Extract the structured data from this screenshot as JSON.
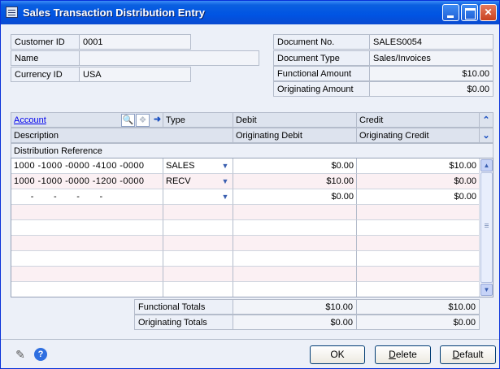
{
  "window": {
    "title": "Sales Transaction Distribution Entry"
  },
  "header": {
    "customer_id_label": "Customer ID",
    "customer_id": "0001",
    "name_label": "Name",
    "name": "",
    "currency_id_label": "Currency ID",
    "currency_id": "USA",
    "document_no_label": "Document No.",
    "document_no": "SALES0054",
    "document_type_label": "Document Type",
    "document_type": "Sales/Invoices",
    "functional_amount_label": "Functional Amount",
    "functional_amount": "$10.00",
    "originating_amount_label": "Originating Amount",
    "originating_amount": "$0.00"
  },
  "grid_header": {
    "account": "Account",
    "type": "Type",
    "debit": "Debit",
    "credit": "Credit",
    "description": "Description",
    "originating_debit": "Originating Debit",
    "originating_credit": "Originating Credit",
    "distribution_reference": "Distribution Reference"
  },
  "rows": [
    {
      "account": "1000 -1000 -0000 -4100 -0000",
      "type": "SALES",
      "debit": "$0.00",
      "credit": "$10.00"
    },
    {
      "account": "1000 -1000 -0000 -1200 -0000",
      "type": "RECV",
      "debit": "$10.00",
      "credit": "$0.00"
    },
    {
      "account": "      -       -       -       -",
      "type": "",
      "debit": "$0.00",
      "credit": "$0.00"
    }
  ],
  "totals": {
    "functional_label": "Functional Totals",
    "functional_debit": "$10.00",
    "functional_credit": "$10.00",
    "originating_label": "Originating Totals",
    "originating_debit": "$0.00",
    "originating_credit": "$0.00"
  },
  "buttons": {
    "ok": "OK",
    "delete_rest": "elete",
    "delete_key": "D",
    "default_rest": "efault",
    "default_key": "D"
  },
  "icons": {
    "lookup": "magnifier-icon",
    "expand": "expand-icon",
    "go": "arrow-right-icon",
    "note": "note-icon",
    "help": "help-icon"
  }
}
